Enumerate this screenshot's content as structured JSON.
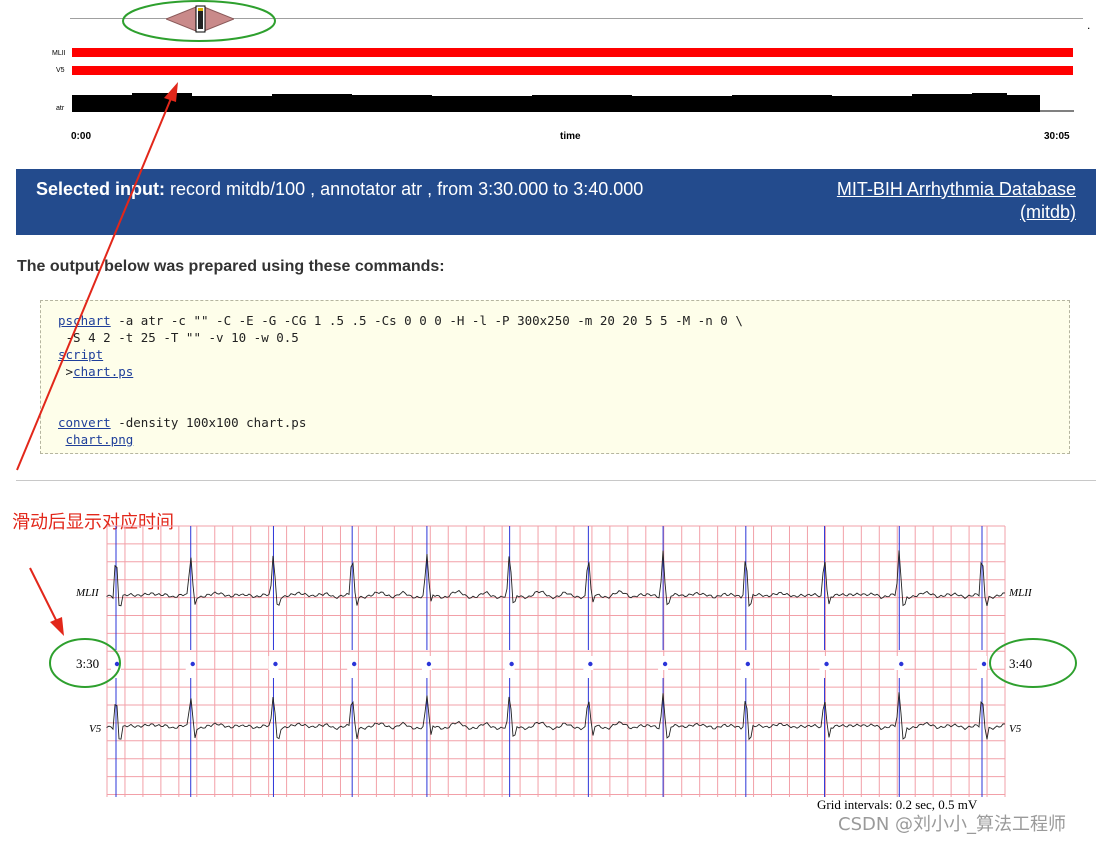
{
  "navigator": {
    "signals": [
      "MLII",
      "V5",
      "atr"
    ],
    "time_start": "0:00",
    "time_axis_label": "time",
    "time_end": "30:05",
    "dot": "."
  },
  "banner": {
    "selected_label": "Selected input:",
    "selected_text": " record mitdb/100 , annotator atr , from 3:30.000 to 3:40.000",
    "database_link": "MIT-BIH Arrhythmia Database (mitdb)"
  },
  "commands": {
    "heading": "The output below was prepared using these commands:",
    "line1_cmd": "pschart",
    "line1_args": " -a atr -c \"\" -C -E -G -CG 1 .5 .5 -Cs 0 0 0 -H -l -P 300x250 -m 20 20 5 5 -M -n 0 \\",
    "line2": " -S 4 2 -t 25 -T \"\" -v 10 -w 0.5",
    "line3_link": "script",
    "line4_prefix": " >",
    "line4_link": "chart.ps",
    "line5_cmd": "convert",
    "line5_args": " -density 100x100 chart.ps",
    "line6_link": "chart.png"
  },
  "annotation": {
    "chinese_label": "滑动后显示对应时间",
    "arrow_color": "#e2271a",
    "circle_color": "#2ea02e"
  },
  "ecg": {
    "lead_top": "MLII",
    "lead_bottom": "V5",
    "start_time": "3:30",
    "end_time": "3:40",
    "grid_note": "Grid intervals: 0.2 sec, 0.5 mV",
    "beat_count": 12
  },
  "watermark": "CSDN @刘小小_算法工程师",
  "colors": {
    "banner_bg": "#234b8d",
    "signal_red": "#ff0000",
    "grid_pink": "#f2a0a8",
    "annotation_blue": "#2b35d8",
    "cmd_bg": "#fefeea"
  }
}
